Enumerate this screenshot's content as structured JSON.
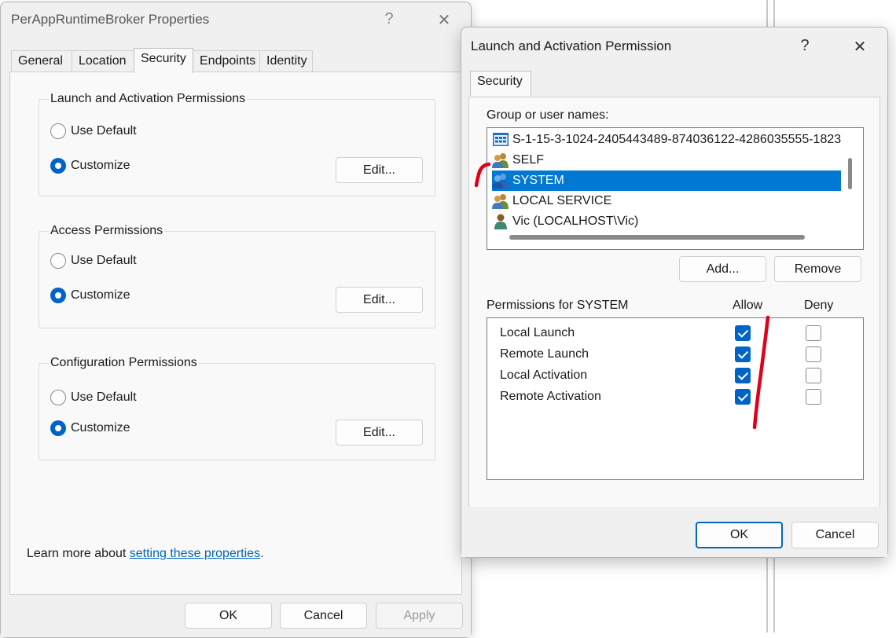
{
  "properties_window": {
    "title": "PerAppRuntimeBroker Properties",
    "help_glyph": "?",
    "close_glyph": "✕",
    "tabs": [
      {
        "label": "General",
        "active": false
      },
      {
        "label": "Location",
        "active": false
      },
      {
        "label": "Security",
        "active": true
      },
      {
        "label": "Endpoints",
        "active": false
      },
      {
        "label": "Identity",
        "active": false
      }
    ],
    "groups": [
      {
        "title": "Launch and Activation Permissions",
        "use_default": "Use Default",
        "customize": "Customize",
        "selected": "customize",
        "edit": "Edit..."
      },
      {
        "title": "Access Permissions",
        "use_default": "Use Default",
        "customize": "Customize",
        "selected": "customize",
        "edit": "Edit..."
      },
      {
        "title": "Configuration Permissions",
        "use_default": "Use Default",
        "customize": "Customize",
        "selected": "customize",
        "edit": "Edit..."
      }
    ],
    "learn_more_prefix": "Learn more about ",
    "learn_more_link": "setting these properties",
    "learn_more_suffix": ".",
    "ok": "OK",
    "cancel": "Cancel",
    "apply": "Apply"
  },
  "launch_dialog": {
    "title": "Launch and Activation Permission",
    "help_glyph": "?",
    "close_glyph": "✕",
    "tab": "Security",
    "group_label": "Group or user names:",
    "users": [
      {
        "name": "S-1-15-3-1024-2405443489-874036122-4286035555-1823",
        "icon": "app-package-sid-icon",
        "selected": false
      },
      {
        "name": "SELF",
        "icon": "group-users-icon",
        "selected": false
      },
      {
        "name": "SYSTEM",
        "icon": "group-users-icon",
        "selected": true
      },
      {
        "name": "LOCAL SERVICE",
        "icon": "group-users-icon",
        "selected": false
      },
      {
        "name": "Vic (LOCALHOST\\Vic)",
        "icon": "single-user-icon",
        "selected": false
      }
    ],
    "add": "Add...",
    "remove": "Remove",
    "permissions_label": "Permissions for SYSTEM",
    "allow_label": "Allow",
    "deny_label": "Deny",
    "permissions": [
      {
        "name": "Local Launch",
        "allow": true,
        "deny": false
      },
      {
        "name": "Remote Launch",
        "allow": true,
        "deny": false
      },
      {
        "name": "Local Activation",
        "allow": true,
        "deny": false
      },
      {
        "name": "Remote Activation",
        "allow": true,
        "deny": false
      }
    ],
    "ok": "OK",
    "cancel": "Cancel"
  },
  "colors": {
    "accent": "#0063c8",
    "selection": "#0078d4",
    "annotation": "#e0001b",
    "link": "#0066b8"
  }
}
